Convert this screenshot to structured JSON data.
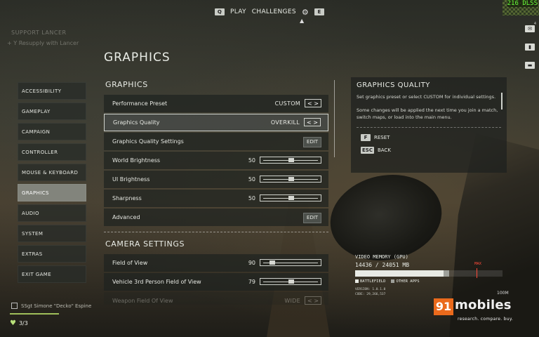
{
  "topbar": {
    "key_left": "Q",
    "play": "PLAY",
    "challenges": "CHALLENGES",
    "key_right": "E",
    "fps": "216 DLSS"
  },
  "support": {
    "title": "SUPPORT LANCER",
    "hint_key": "Y",
    "hint": "Resupply with Lancer"
  },
  "page_title": "GRAPHICS",
  "nav": [
    {
      "label": "ACCESSIBILITY"
    },
    {
      "label": "GAMEPLAY"
    },
    {
      "label": "CAMPAIGN"
    },
    {
      "label": "CONTROLLER"
    },
    {
      "label": "MOUSE & KEYBOARD"
    },
    {
      "label": "GRAPHICS",
      "active": true
    },
    {
      "label": "AUDIO"
    },
    {
      "label": "SYSTEM"
    },
    {
      "label": "EXTRAS"
    },
    {
      "label": "EXIT GAME"
    }
  ],
  "graphics_section": {
    "title": "GRAPHICS",
    "rows": [
      {
        "label": "Performance Preset",
        "value": "CUSTOM",
        "control": "arrows"
      },
      {
        "label": "Graphics Quality",
        "value": "OVERKILL",
        "control": "arrows",
        "selected": true
      },
      {
        "label": "Graphics Quality Settings",
        "control": "edit",
        "edit_label": "EDIT"
      },
      {
        "label": "World Brightness",
        "value": "50",
        "control": "slider",
        "level": 0.5
      },
      {
        "label": "UI Brightness",
        "value": "50",
        "control": "slider",
        "level": 0.5
      },
      {
        "label": "Sharpness",
        "value": "50",
        "control": "slider",
        "level": 0.5
      },
      {
        "label": "Advanced",
        "control": "edit",
        "edit_label": "EDIT"
      }
    ]
  },
  "camera_section": {
    "title": "CAMERA SETTINGS",
    "rows": [
      {
        "label": "Field of View",
        "value": "90",
        "level": 0.12
      },
      {
        "label": "Vehicle 3rd Person Field of View",
        "value": "79",
        "level": 0.5
      },
      {
        "label": "Weapon Field Of View",
        "value": "WIDE"
      }
    ]
  },
  "description": {
    "title": "GRAPHICS QUALITY",
    "text1": "Set graphics preset or select CUSTOM for individual settings.",
    "text2": "Some changes will be applied the next time you join a match, switch maps, or load into the main menu.",
    "reset_key": "F",
    "reset": "RESET",
    "back_key": "ESC",
    "back": "BACK"
  },
  "vram": {
    "title": "VIDEO MEMORY (GPU)",
    "value": "14436 / 24051 MB",
    "max_label": "MAX",
    "legend_battlefield": "BATTLEFIELD",
    "legend_other": "OTHER APPS",
    "version": "VERSION: 1.0.1.0",
    "code": "CODE: 29,266,537",
    "battlefield_fraction": 0.6
  },
  "hud": {
    "count_top": "4",
    "distance": "100M"
  },
  "squad": {
    "player": "SSgt Simone \"Decko\" Espine",
    "lives": "3/3"
  },
  "watermark": {
    "number": "91",
    "brand": "mobiles",
    "tagline": "research. compare. buy."
  },
  "colors": {
    "accent_max": "#ff4a3a",
    "watermark_orange": "#ea6a1c",
    "fps_green": "#6aff3a"
  }
}
